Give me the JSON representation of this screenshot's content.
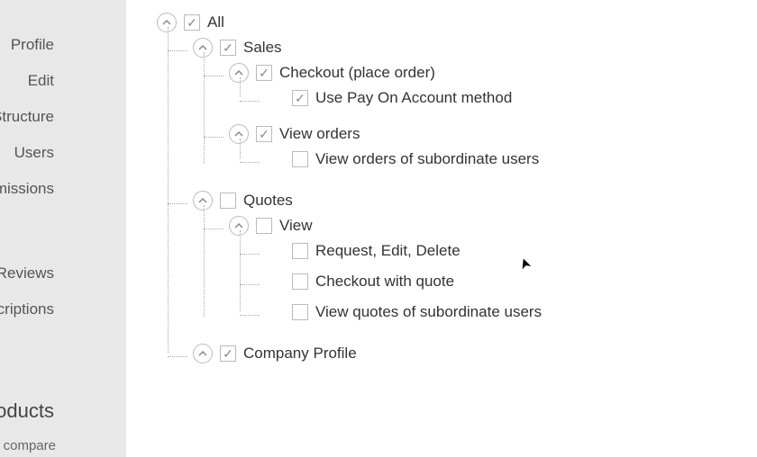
{
  "sidebar": {
    "items": [
      {
        "label": "Profile"
      },
      {
        "label": "Edit"
      },
      {
        "label": "Structure"
      },
      {
        "label": "Users"
      },
      {
        "label": "Permissions"
      },
      {
        "label": "Reviews"
      },
      {
        "label": "Subscriptions"
      }
    ],
    "heading": "Products",
    "subtext": "Add to compare"
  },
  "tree": {
    "root": {
      "label": "All",
      "checked": true,
      "expandable": true,
      "children": [
        {
          "label": "Sales",
          "checked": true,
          "expandable": true,
          "children": [
            {
              "label": "Checkout (place order)",
              "checked": true,
              "expandable": true,
              "children": [
                {
                  "label": "Use Pay On Account method",
                  "checked": true,
                  "expandable": false
                }
              ]
            },
            {
              "label": "View orders",
              "checked": true,
              "expandable": true,
              "children": [
                {
                  "label": "View orders of subordinate users",
                  "checked": false,
                  "expandable": false
                }
              ]
            }
          ]
        },
        {
          "label": "Quotes",
          "checked": false,
          "expandable": true,
          "children": [
            {
              "label": "View",
              "checked": false,
              "expandable": true,
              "children": [
                {
                  "label": "Request, Edit, Delete",
                  "checked": false,
                  "expandable": false
                },
                {
                  "label": "Checkout with quote",
                  "checked": false,
                  "expandable": false
                },
                {
                  "label": "View quotes of subordinate users",
                  "checked": false,
                  "expandable": false
                }
              ]
            }
          ]
        },
        {
          "label": "Company Profile",
          "checked": true,
          "expandable": true,
          "children": []
        }
      ]
    }
  }
}
